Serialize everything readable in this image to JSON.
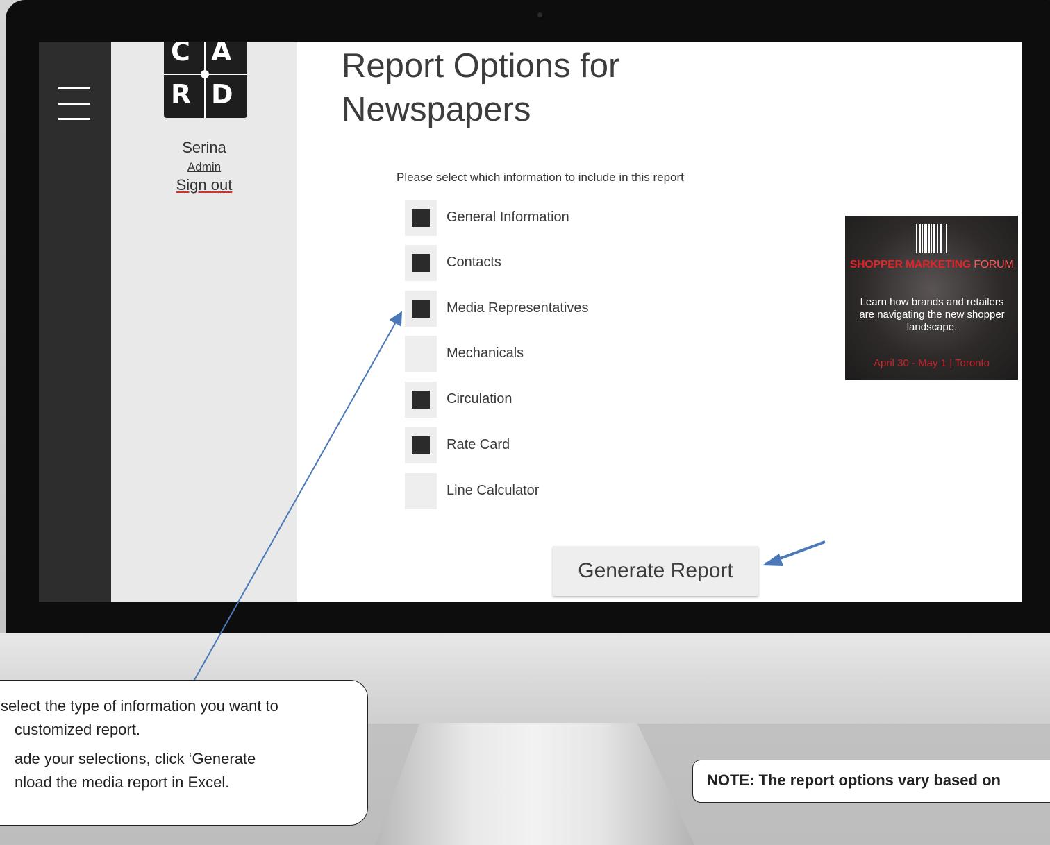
{
  "sidebar": {
    "logo": [
      "C",
      "A",
      "R",
      "D"
    ],
    "user_name": "Serina",
    "user_role": "Admin",
    "sign_out": "Sign out"
  },
  "main": {
    "title": "Report Options for Newspapers",
    "instructions": "Please select which information to include in this report",
    "options": [
      {
        "label": "General Information",
        "checked": true
      },
      {
        "label": "Contacts",
        "checked": true
      },
      {
        "label": "Media Representatives",
        "checked": true
      },
      {
        "label": "Mechanicals",
        "checked": false
      },
      {
        "label": "Circulation",
        "checked": true
      },
      {
        "label": "Rate Card",
        "checked": true
      },
      {
        "label": "Line Calculator",
        "checked": false
      }
    ],
    "generate_button": "Generate Report"
  },
  "ad": {
    "title_part1": "SHOPPER MARKETING",
    "title_part2": "FORUM",
    "text": "Learn how brands and retailers are navigating the new shopper landscape.",
    "date": "April 30 - May 1 | Toronto"
  },
  "callouts": {
    "left_lines": [
      "select the type of information you want to",
      "customized report.",
      "ade your selections, click ‘Generate",
      "nload the media report in Excel."
    ],
    "right": "NOTE: The report options vary based on"
  },
  "colors": {
    "nav_dark": "#2d2d2d",
    "panel_grey": "#e9e9e9",
    "checkbox_fill": "#2b2b2b",
    "annotation_arrow": "#4a78b8",
    "ad_red": "#e2232a"
  }
}
